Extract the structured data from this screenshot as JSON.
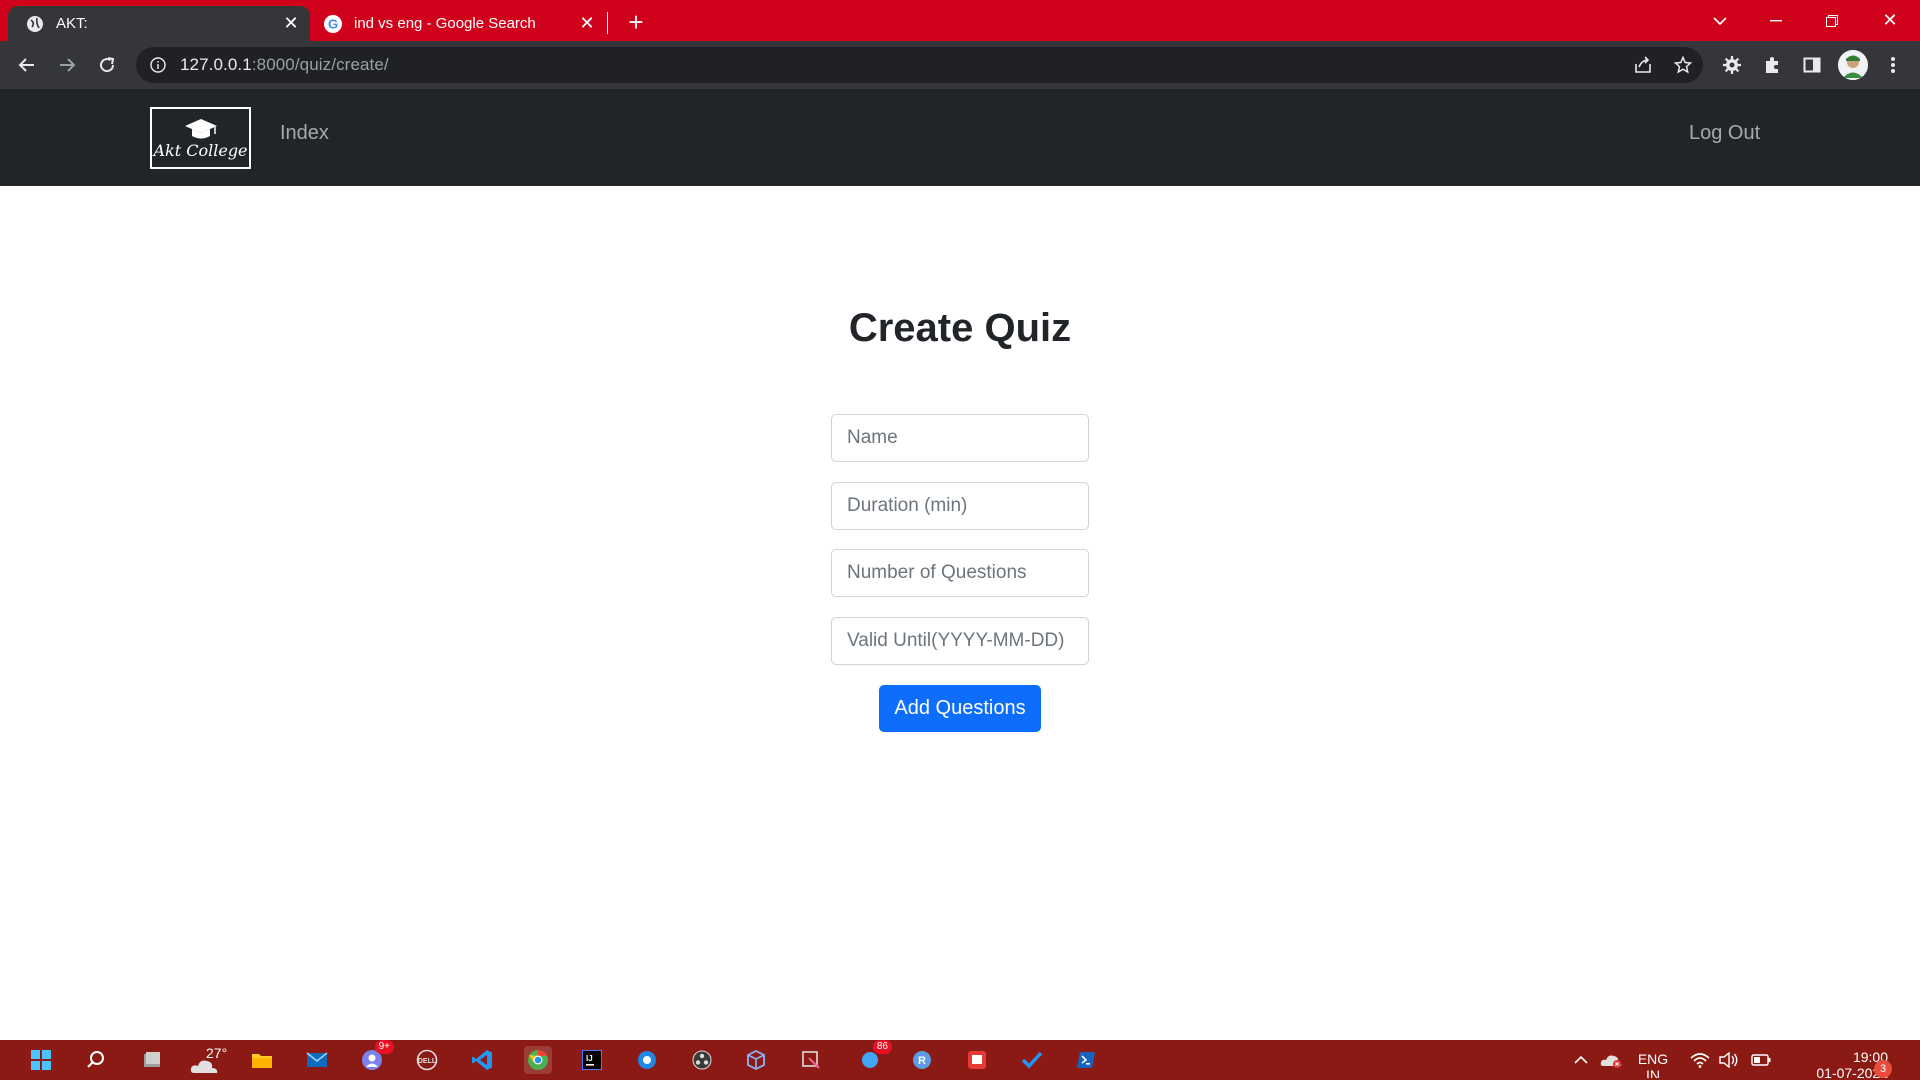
{
  "browser": {
    "tabs": [
      {
        "title": "AKT:",
        "icon": "globe-icon",
        "active": true
      },
      {
        "title": "ind vs eng - Google Search",
        "icon": "google-icon",
        "active": false
      }
    ],
    "url_host": "127.0.0.1",
    "url_rest": ":8000/quiz/create/",
    "accent": "#d0021b"
  },
  "navbar": {
    "brand_text": "Akt College",
    "links": {
      "index": "Index",
      "logout": "Log Out"
    }
  },
  "main": {
    "title": "Create Quiz",
    "fields": {
      "name": {
        "placeholder": "Name",
        "value": ""
      },
      "duration": {
        "placeholder": "Duration (min)",
        "value": ""
      },
      "num_questions": {
        "placeholder": "Number of Questions",
        "value": ""
      },
      "valid_until": {
        "placeholder": "Valid Until(YYYY-MM-DD)",
        "value": ""
      }
    },
    "submit_label": "Add Questions",
    "button_color": "#0d6efd"
  },
  "taskbar": {
    "weather_temp": "27°",
    "teams_badge": "9+",
    "notif_badge": "86",
    "language_top": "ENG",
    "language_bottom": "IN",
    "time": "19:00",
    "date": "01-07-2022",
    "notification_count": "3"
  }
}
